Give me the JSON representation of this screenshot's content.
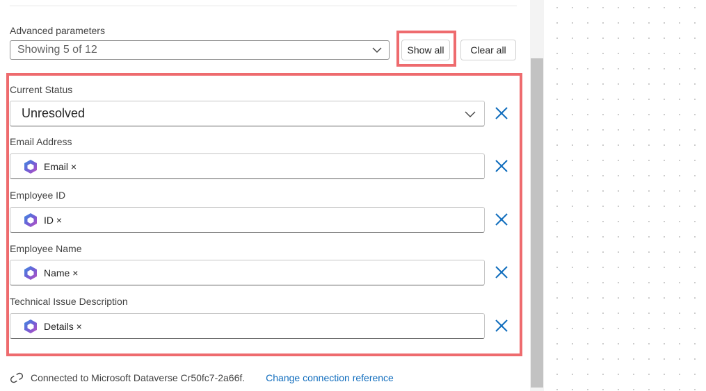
{
  "advanced": {
    "label": "Advanced parameters",
    "select_value": "Showing 5 of 12",
    "show_all_label": "Show all",
    "clear_all_label": "Clear all"
  },
  "fields": [
    {
      "label": "Current Status",
      "value": "Unresolved",
      "type": "dropdown"
    },
    {
      "label": "Email Address",
      "token": "Email ×",
      "type": "token"
    },
    {
      "label": "Employee ID",
      "token": "ID ×",
      "type": "token"
    },
    {
      "label": "Employee Name",
      "token": "Name ×",
      "type": "token"
    },
    {
      "label": "Technical Issue Description",
      "token": "Details ×",
      "type": "token"
    }
  ],
  "footer": {
    "connection_text": "Connected to Microsoft Dataverse Cr50fc7-2a66f.",
    "change_link": "Change connection reference"
  },
  "colors": {
    "highlight": "#ee6b6e",
    "link": "#0f6cbd",
    "remove_icon": "#0f6cbd"
  },
  "icons": {
    "token_logo": "copilot-studio-logo-icon",
    "remove": "close-icon",
    "dropdown": "chevron-down-icon",
    "connection": "link-icon"
  }
}
